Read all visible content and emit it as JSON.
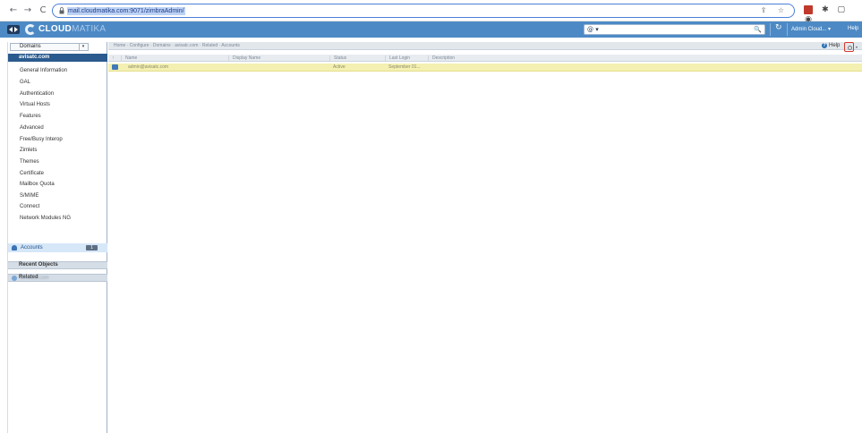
{
  "browser": {
    "url": "mail.cloudmatika.com:9071/zimbraAdmin/",
    "back": "←",
    "forward": "→",
    "reload": "C",
    "url_actions": "⇪ ☆",
    "extensions": [
      "✱",
      "▢",
      "◉"
    ]
  },
  "header": {
    "logo_bold": "CLOUD",
    "logo_light": "MATIKA",
    "search_mode": "@ ▾",
    "search_placeholder": "",
    "search_icon": "🔍",
    "refresh_icon": "↻",
    "admin_menu": "Admin Cloud... ▾",
    "help": "Help"
  },
  "sidebar": {
    "dropdown": "Domains",
    "selected_domain": "avisatc.com",
    "items": [
      "General Information",
      "GAL",
      "Authentication",
      "Virtual Hosts",
      "Features",
      "Advanced",
      "Free/Busy Interop",
      "Zimlets",
      "Themes",
      "Certificate",
      "Mailbox Quota",
      "S/MIME",
      "Connect",
      "Network Modules NG"
    ],
    "related_header": "Related",
    "related_item": {
      "label": "Accounts",
      "count": "1"
    },
    "recent_header": "Recent Objects",
    "recent_item": "avisatc.com"
  },
  "content": {
    "breadcrumb": "Home · Configure · Domains · avisatc.com · Related · Accounts",
    "help_label": "Help",
    "columns": [
      "Name",
      "Display Name",
      "Status",
      "Last Login",
      "Description"
    ],
    "rows": [
      {
        "name": "admin@avisatc.com",
        "display_name": "",
        "status": "Active",
        "last_login": "September 01...",
        "description": ""
      }
    ]
  }
}
